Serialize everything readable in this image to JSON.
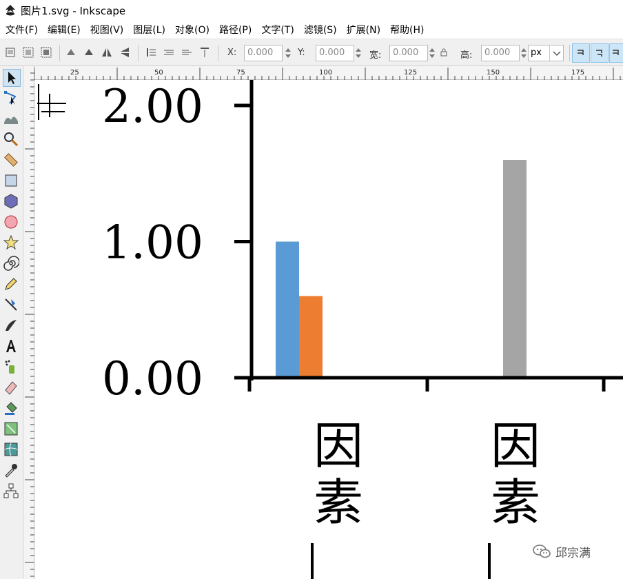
{
  "window": {
    "title": "图片1.svg - Inkscape"
  },
  "menu": [
    "文件(F)",
    "编辑(E)",
    "视图(V)",
    "图层(L)",
    "对象(O)",
    "路径(P)",
    "文字(T)",
    "滤镜(S)",
    "扩展(N)",
    "帮助(H)"
  ],
  "toolbar": {
    "x": {
      "label": "X:",
      "value": "0.000"
    },
    "y": {
      "label": "Y:",
      "value": "0.000"
    },
    "w": {
      "label": "宽:",
      "value": "0.000"
    },
    "h": {
      "label": "高:",
      "value": "0.000"
    },
    "unit": "px"
  },
  "ruler": {
    "marks": [
      "25",
      "50",
      "75",
      "100",
      "125",
      "150",
      "175"
    ]
  },
  "tools": [
    "selector-icon",
    "node-icon",
    "tweak-icon",
    "zoom-icon",
    "measure-icon",
    "rectangle-icon",
    "box3d-icon",
    "ellipse-icon",
    "star-icon",
    "spiral-icon",
    "pencil-icon",
    "pen-icon",
    "calligraphy-icon",
    "text-icon",
    "spray-icon",
    "eraser-icon",
    "paint-bucket-icon",
    "gradient-icon",
    "mesh-icon",
    "dropper-icon",
    "connector-icon"
  ],
  "watermark": {
    "text": "邱宗满",
    "icon": "wechat-icon"
  },
  "colors": {
    "series1": "#5b9bd5",
    "series2": "#ed7d31",
    "series3": "#a5a5a5"
  },
  "chart_data": {
    "type": "bar",
    "title": "",
    "xlabel": "",
    "ylabel": "",
    "ylim": [
      0,
      2.0
    ],
    "yticks": [
      "0.00",
      "1.00",
      "2.00"
    ],
    "categories": [
      "因素",
      "因素"
    ],
    "series": [
      {
        "values": [
          1.0,
          null
        ],
        "color": "#5b9bd5"
      },
      {
        "values": [
          0.6,
          null
        ],
        "color": "#ed7d31"
      },
      {
        "values": [
          null,
          1.6
        ],
        "color": "#a5a5a5"
      }
    ],
    "grid": false
  }
}
